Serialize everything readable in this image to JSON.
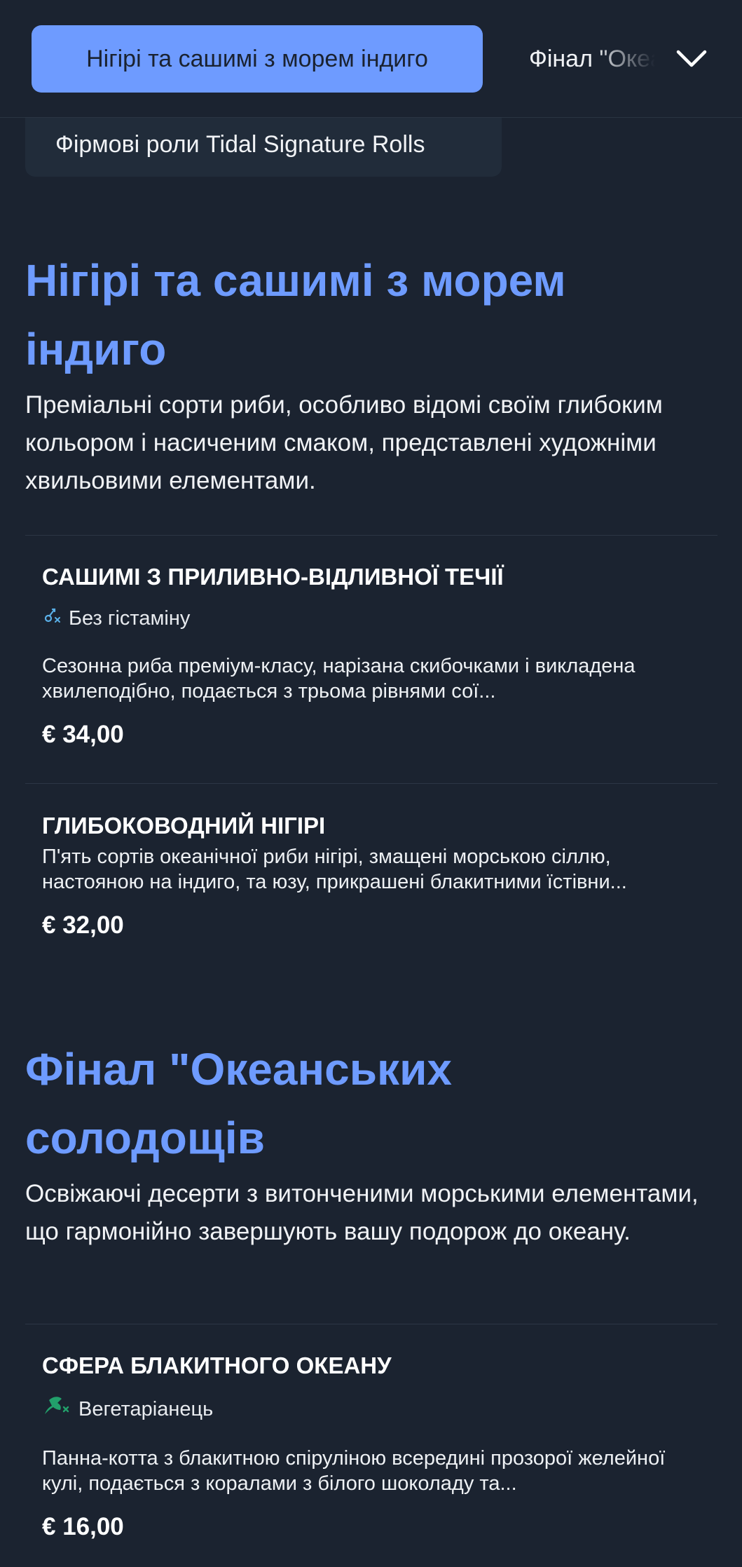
{
  "nav": {
    "active_label": "Нігірі та сашимі з морем індиго",
    "next_label": "Фінал \"Океанських солодощів",
    "previous_label": "Фірмові роли Tidal Signature Rolls"
  },
  "sections": [
    {
      "title": "Нігірі та сашимі з морем індиго",
      "description": "Преміальні сорти риби, особливо відомі своїм глибоким кольором і насиченим смаком, представлені художніми хвильовими елементами.",
      "items": [
        {
          "name": "САШИМІ З ПРИЛИВНО-ВІДЛИВНОЇ ТЕЧІЇ",
          "tag": "Без гістаміну",
          "tag_icon": "histamine-free-icon",
          "description": "Сезонна риба преміум-класу, нарізана скибочками і викладена хвилеподібно, подається з трьома рівнями сої...",
          "price": "€ 34,00"
        },
        {
          "name": "ГЛИБОКОВОДНИЙ НІГІРІ",
          "description": "П'ять сортів океанічної риби нігірі, змащені морською сіллю, настояною на індиго, та юзу, прикрашені блакитними їстівни...",
          "price": "€ 32,00"
        }
      ]
    },
    {
      "title": "Фінал \"Океанських солодощів",
      "description": "Освіжаючі десерти з витонченими морськими елементами, що гармонійно завершують вашу подорож до океану.",
      "items": [
        {
          "name": "СФЕРА БЛАКИТНОГО ОКЕАНУ",
          "tag": "Вегетаріанець",
          "tag_icon": "vegetarian-icon",
          "description": "Панна-котта з блакитною спіруліною всередині прозорої желейної кулі, подається з коралами з білого шоколаду та...",
          "price": "€ 16,00"
        }
      ]
    }
  ],
  "colors": {
    "background": "#1b2330",
    "accent": "#6e9bff",
    "histamine_icon": "#5ab0e8",
    "vegetarian_icon": "#22a06b"
  }
}
